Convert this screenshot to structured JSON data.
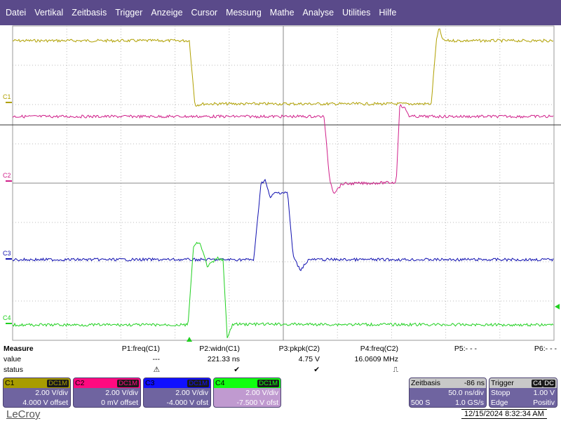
{
  "menu": [
    "Datei",
    "Vertikal",
    "Zeitbasis",
    "Trigger",
    "Anzeige",
    "Cursor",
    "Messung",
    "Mathe",
    "Analyse",
    "Utilities",
    "Hilfe"
  ],
  "traces": [
    {
      "label": "C1",
      "color": "#b0a000"
    },
    {
      "label": "C2",
      "color": "#d0208a"
    },
    {
      "label": "C3",
      "color": "#1010b0"
    },
    {
      "label": "C4",
      "color": "#20d020"
    }
  ],
  "measure": {
    "title": "Measure",
    "row_value": "value",
    "row_status": "status",
    "params": [
      {
        "name": "P1:freq(C1)",
        "value": "---",
        "status": "⚠"
      },
      {
        "name": "P2:widn(C1)",
        "value": "221.33 ns",
        "status": "✔"
      },
      {
        "name": "P3:pkpk(C2)",
        "value": "4.75 V",
        "status": "✔"
      },
      {
        "name": "P4:freq(C2)",
        "value": "16.0609 MHz",
        "status": "⎍"
      },
      {
        "name": "P5:- - -",
        "value": "",
        "status": ""
      },
      {
        "name": "P6:- - -",
        "value": "",
        "status": ""
      }
    ]
  },
  "channels": [
    {
      "label": "C1",
      "coupling": "DC1M",
      "scale": "2.00 V/div",
      "offset": "4.000 V offset",
      "color": "#a89c00",
      "bg": "#6f64a0"
    },
    {
      "label": "C2",
      "coupling": "DC1M",
      "scale": "2.00 V/div",
      "offset": "0 mV offset",
      "color": "#ff0a80",
      "bg": "#6f64a0"
    },
    {
      "label": "C3",
      "coupling": "DC1M",
      "scale": "2.00 V/div",
      "offset": "-4.000 V ofst",
      "color": "#1010ff",
      "bg": "#6f64a0"
    },
    {
      "label": "C4",
      "coupling": "DC1M",
      "scale": "2.00 V/div",
      "offset": "-7.500 V ofst",
      "color": "#10ff10",
      "bg": "#c09ad0"
    }
  ],
  "timebase": {
    "title": "Zeitbasis",
    "delay": "-86 ns",
    "scale": "50.0 ns/div",
    "samples": "500 S",
    "rate": "1.0 GS/s"
  },
  "trigger": {
    "title": "Trigger",
    "source": "C4",
    "coupling": "DC",
    "mode": "Stopp",
    "level": "1.00 V",
    "type": "Edge",
    "slope": "Positiv"
  },
  "logo": "LeCroy",
  "datetime": "12/15/2024 8:32:34 AM"
}
